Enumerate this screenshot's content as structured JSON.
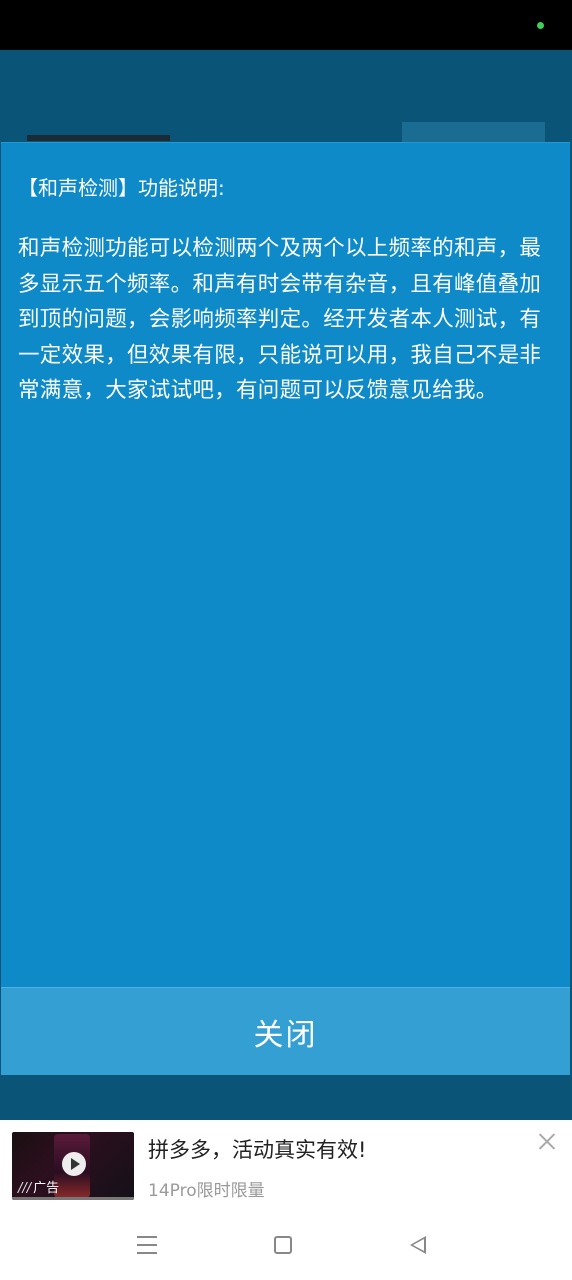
{
  "dialog": {
    "title": "【和声检测】功能说明:",
    "body": "和声检测功能可以检测两个及两个以上频率的和声，最多显示五个频率。和声有时会带有杂音，且有峰值叠加到顶的问题，会影响频率判定。经开发者本人测试，有一定效果，但效果有限，只能说可以用，我自己不是非常满意，大家试试吧，有问题可以反馈意见给我。",
    "close_label": "关闭"
  },
  "ad": {
    "tag": "广告",
    "title": "拼多多，活动真实有效!",
    "subtitle": "14Pro限时限量",
    "close_icon": "close-icon",
    "play_icon": "play-icon"
  },
  "nav": {
    "menu_icon": "menu-icon",
    "home_icon": "home-icon",
    "back_icon": "back-icon"
  },
  "colors": {
    "dialog_bg": "#0d8ac7",
    "close_bar_bg": "#349fd3",
    "app_bg": "#0a5478",
    "status_dot": "#3ecf5a"
  }
}
